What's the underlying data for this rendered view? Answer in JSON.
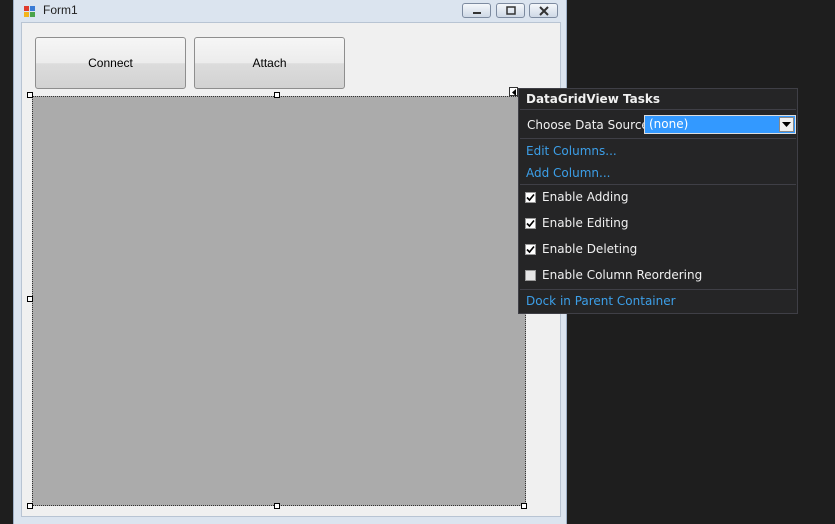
{
  "window": {
    "title": "Form1",
    "buttons": [
      "minimize-icon",
      "maximize-icon",
      "close-icon"
    ]
  },
  "form": {
    "connect_label": "Connect",
    "attach_label": "Attach"
  },
  "tasks_panel": {
    "title": "DataGridView Tasks",
    "data_source_label": "Choose Data Source:",
    "data_source_value": "(none)",
    "edit_columns": "Edit Columns...",
    "add_column": "Add Column...",
    "options": [
      {
        "label": "Enable Adding",
        "checked": true
      },
      {
        "label": "Enable Editing",
        "checked": true
      },
      {
        "label": "Enable Deleting",
        "checked": true
      },
      {
        "label": "Enable Column Reordering",
        "checked": false
      }
    ],
    "dock_link": "Dock in Parent Container"
  },
  "colors": {
    "designer_background": "#1e1e1e",
    "panel_background": "#252526",
    "link": "#3c9fe8",
    "selection": "#3399ff",
    "grid_fill": "#ababab"
  }
}
